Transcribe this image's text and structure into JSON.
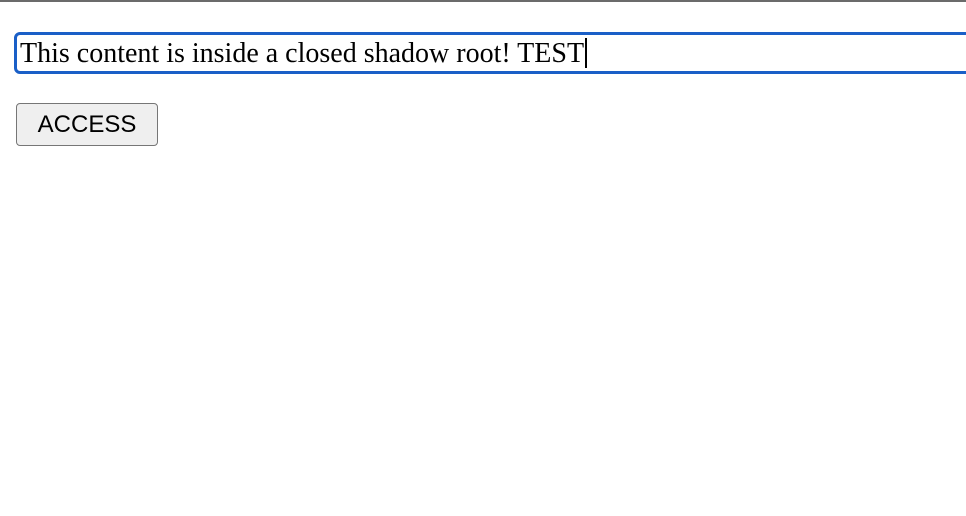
{
  "content": {
    "text": "This content is inside a closed shadow root! TEST"
  },
  "access_button": {
    "label": "ACCESS"
  },
  "colors": {
    "focus_border": "#1a5fc7",
    "button_bg": "#efefef",
    "button_border": "#767676"
  }
}
